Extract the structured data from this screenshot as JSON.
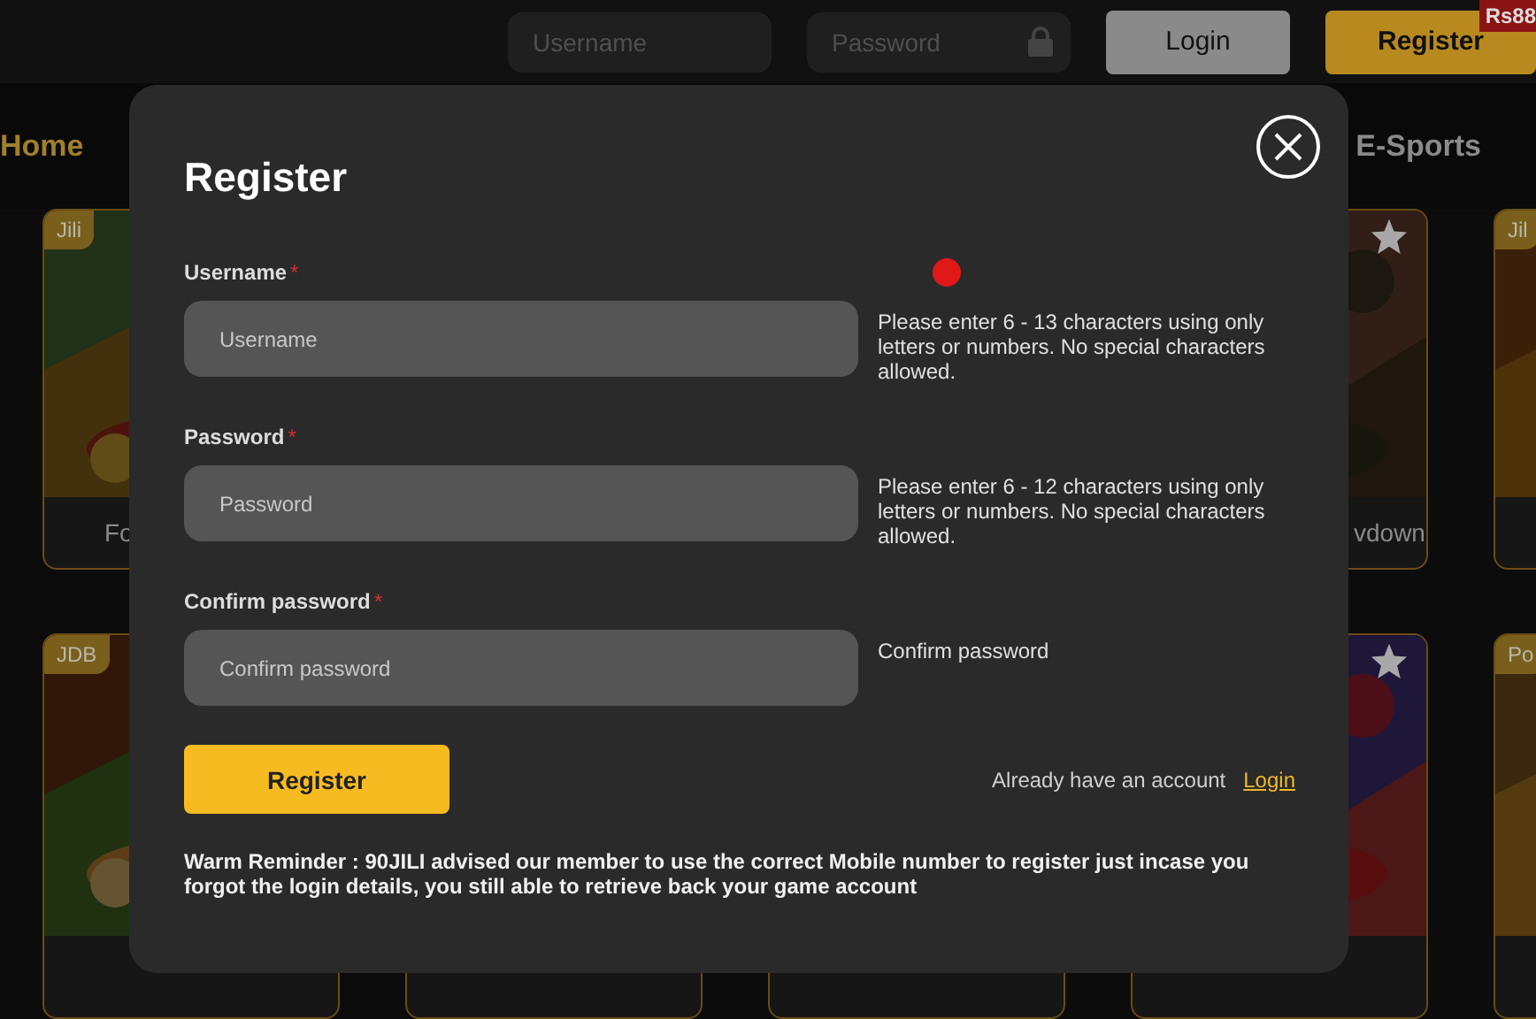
{
  "header": {
    "username_placeholder": "Username",
    "password_placeholder": "Password",
    "buttons": [
      {
        "label": "Login",
        "kind": "login"
      },
      {
        "label": "Register",
        "kind": "register"
      }
    ],
    "badge": "Rs88"
  },
  "nav": {
    "items": [
      {
        "label": "Home",
        "selected": true
      },
      {
        "label": "E-Sports",
        "selected": false
      }
    ]
  },
  "games": [
    {
      "tag": "Jili",
      "name": "Fo",
      "favorite": false
    },
    {
      "name": "vdown",
      "favorite": true
    },
    {
      "tag": "Jil",
      "favorite": false
    },
    {
      "tag": "JDB",
      "favorite": false
    },
    {
      "favorite": true
    },
    {
      "tag": "Po",
      "favorite": false
    }
  ],
  "modal": {
    "title": "Register",
    "fields": [
      {
        "label": "Username",
        "required_mark": "*",
        "placeholder": "Username",
        "hint": "Please enter 6 - 13 characters using only letters or numbers. No special characters allowed."
      },
      {
        "label": "Password",
        "required_mark": "*",
        "placeholder": "Password",
        "hint": "Please enter 6 - 12 characters using only letters or numbers. No special characters allowed."
      },
      {
        "label": "Confirm password",
        "required_mark": "*",
        "placeholder": "Confirm password",
        "hint": "Confirm password"
      }
    ],
    "submit": "Register",
    "account_prompt": "Already have an account",
    "login_link": "Login",
    "reminder": "Warm Reminder : 90JILI advised our member to use the correct Mobile number to register just incase you forgot the login details, you still able to retrieve back your game account"
  }
}
